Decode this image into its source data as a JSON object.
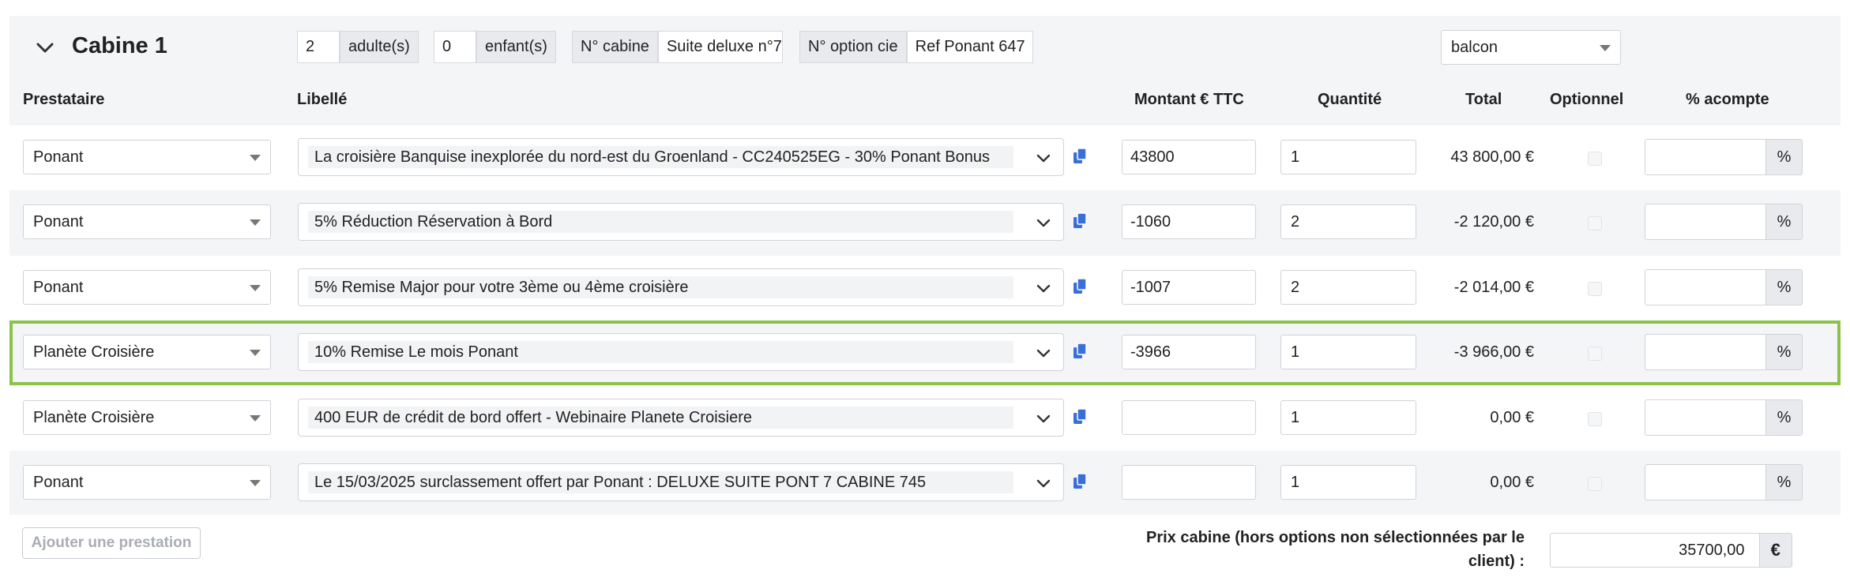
{
  "cabin": {
    "title": "Cabine 1",
    "adults_value": "2",
    "adults_label": "adulte(s)",
    "children_value": "0",
    "children_label": "enfant(s)",
    "cabin_no_label": "N° cabine",
    "cabin_no_value": "Suite deluxe n°7",
    "option_label": "N° option cie",
    "option_value": "Ref Ponant 647",
    "category_value": "balcon"
  },
  "headers": {
    "prestataire": "Prestataire",
    "libelle": "Libellé",
    "montant": "Montant € TTC",
    "quantite": "Quantité",
    "total": "Total",
    "optionnel": "Optionnel",
    "acompte": "% acompte"
  },
  "rows": [
    {
      "prestataire": "Ponant",
      "libelle": "La croisière Banquise inexplorée du nord-est du Groenland - CC240525EG - 30% Ponant Bonus",
      "montant": "43800",
      "quantite": "1",
      "total": "43 800,00 €",
      "pct": "%"
    },
    {
      "prestataire": "Ponant",
      "libelle": "5% Réduction Réservation à Bord",
      "montant": "-1060",
      "quantite": "2",
      "total": "-2 120,00 €",
      "pct": "%"
    },
    {
      "prestataire": "Ponant",
      "libelle": "5% Remise Major pour votre 3ème ou 4ème croisière",
      "montant": "-1007",
      "quantite": "2",
      "total": "-2 014,00 €",
      "pct": "%"
    },
    {
      "prestataire": "Planète Croisière",
      "libelle": "10% Remise Le mois Ponant",
      "montant": "-3966",
      "quantite": "1",
      "total": "-3 966,00 €",
      "pct": "%"
    },
    {
      "prestataire": "Planète Croisière",
      "libelle": "400 EUR de crédit de bord offert - Webinaire Planete Croisiere",
      "montant": "",
      "quantite": "1",
      "total": "0,00 €",
      "pct": "%"
    },
    {
      "prestataire": "Ponant",
      "libelle": "Le 15/03/2025 surclassement offert par Ponant : DELUXE SUITE PONT 7 CABINE 745",
      "montant": "",
      "quantite": "1",
      "total": "0,00 €",
      "pct": "%"
    }
  ],
  "footer": {
    "add_button": "Ajouter une prestation",
    "price_label_line1": "Prix cabine (hors options non sélectionnées par le",
    "price_label_line2": "client) :",
    "price_value": "35700,00",
    "currency": "€"
  },
  "colors": {
    "highlight": "#8bc34a",
    "copy_icon": "#3b6fd8"
  },
  "icons": {
    "collapse": "chevron-down-icon",
    "copy": "copy-icon",
    "dropdown": "chevron-down-icon"
  }
}
